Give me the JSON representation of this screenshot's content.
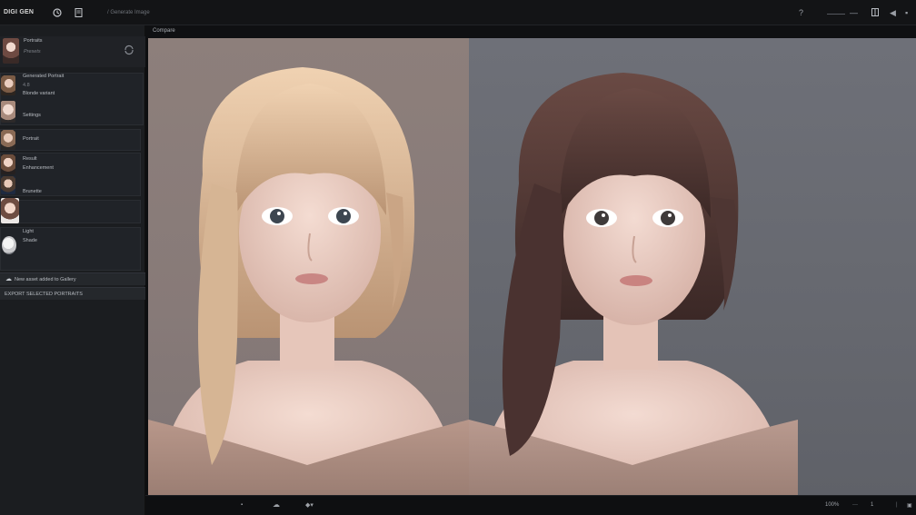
{
  "app": {
    "title": "DIGI GEN"
  },
  "toolbar": {
    "path_text": "/ Generate Image"
  },
  "sidebar": {
    "header": {
      "title": "Portraits",
      "subtitle": "Presets"
    },
    "items": [
      {
        "label": "Generated Portrait",
        "meta": "4.8",
        "sub": "Blonde variant"
      },
      {
        "label": "Settings",
        "meta": "",
        "sub": ""
      },
      {
        "label": "Portrait",
        "meta": "",
        "sub": ""
      },
      {
        "label": "Result",
        "meta": "",
        "sub": ""
      },
      {
        "label": "Enhancement",
        "meta": "",
        "sub": ""
      },
      {
        "label": "Brunette",
        "meta": "",
        "sub": ""
      },
      {
        "label": "Light",
        "meta": "",
        "sub": ""
      },
      {
        "label": "Shade",
        "meta": "",
        "sub": ""
      }
    ],
    "footer_1": "New asset added to Gallery",
    "footer_2": "EXPORT SELECTED PORTRAITS"
  },
  "canvas": {
    "title": "Compare"
  },
  "bottombar": {
    "zoom": "100%",
    "page": "1"
  },
  "colors": {
    "background": "#0d0e10",
    "sidebar": "#1b1d20",
    "panel_left": "#8d7f7b",
    "panel_right": "#6e7078"
  }
}
